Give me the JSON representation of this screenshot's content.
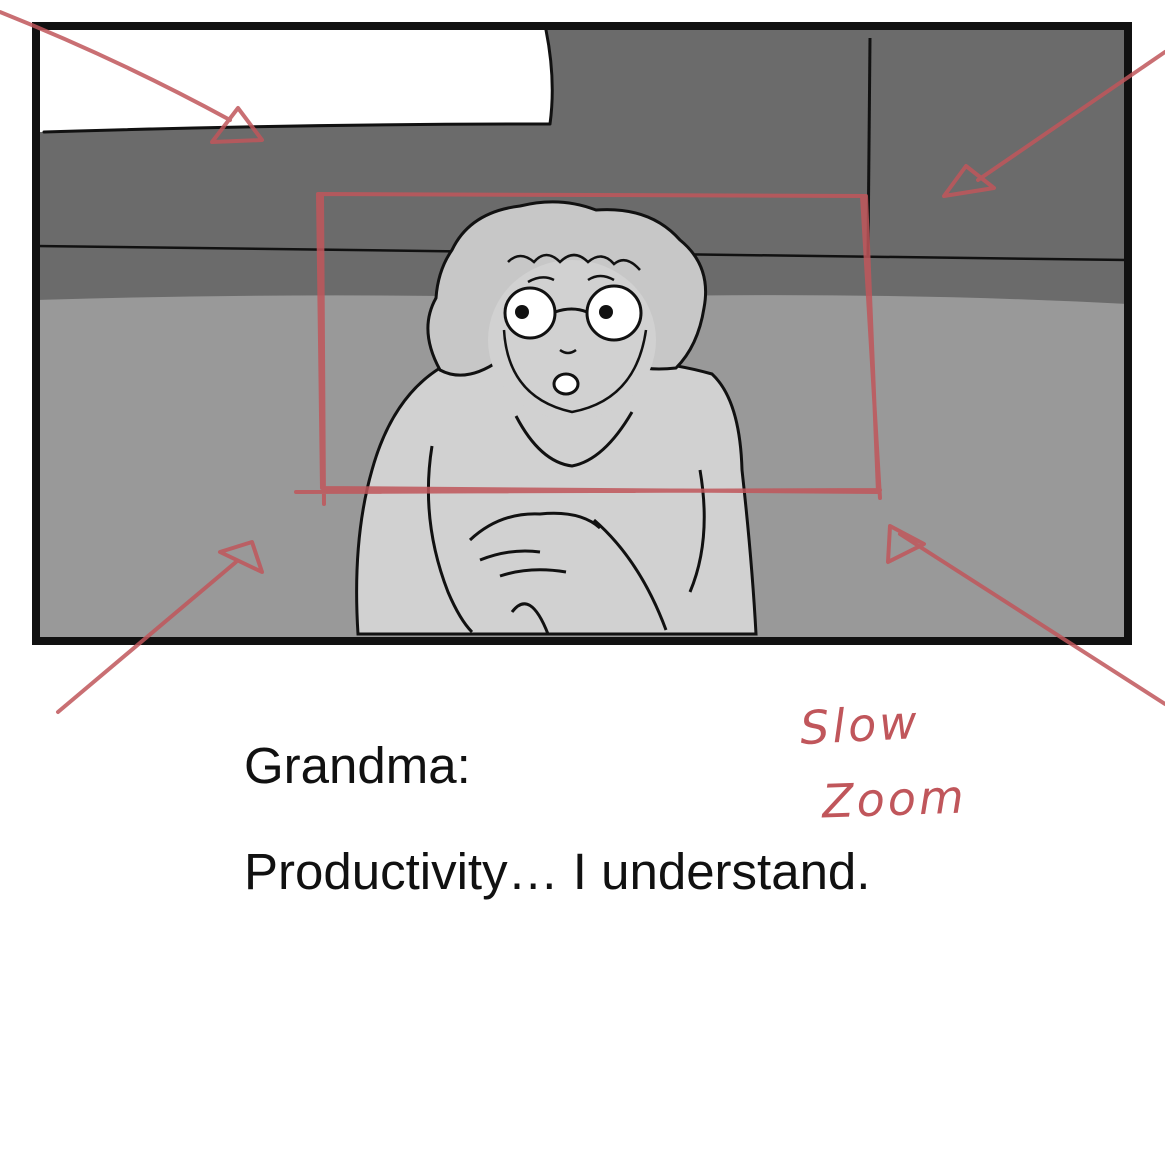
{
  "panel": {
    "speaker": "Grandma:",
    "dialogue": "Productivity… I understand."
  },
  "camera_note": {
    "line1": "Slow",
    "line2": "Zoom"
  },
  "colors": {
    "annotation": "#c0565b",
    "frame": "#111111",
    "wall": "#6b6b6b",
    "floor": "#999999",
    "figure": "#d1d1d1"
  }
}
